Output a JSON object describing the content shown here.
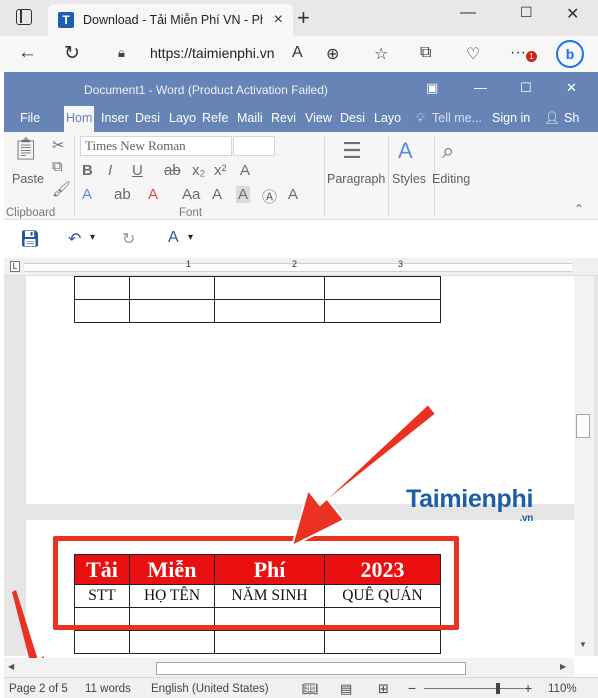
{
  "browser": {
    "tab_title": "Download - Tải Miễn Phí VN - Ph",
    "tab_favicon": "T",
    "url": "https://taimienphi.vn",
    "notification_count": "1",
    "bing_label": "b"
  },
  "word": {
    "window_title": "Document1 - Word (Product Activation Failed)",
    "ribbon_tabs": [
      "File",
      "Hom",
      "Inser",
      "Desi",
      "Layo",
      "Refe",
      "Maili",
      "Revi",
      "View",
      "Desi",
      "Layo"
    ],
    "tell_me": "Tell me...",
    "sign_in": "Sign in",
    "share": "Sh",
    "font_name": "Times New Roman",
    "groups": {
      "clipboard": "Clipboard",
      "font": "Font",
      "paste": "Paste",
      "paragraph": "Paragraph",
      "styles": "Styles",
      "editing": "Editing"
    },
    "ruler_numbers": [
      "1",
      "2",
      "3"
    ],
    "table": {
      "header": [
        "Tải",
        "Miễn",
        "Phí",
        "2023"
      ],
      "row1": [
        "STT",
        "HỌ TÊN",
        "NĂM SINH",
        "QUÊ QUÁN"
      ]
    },
    "watermark_text": "Taimienphi",
    "watermark_suffix": ".vn",
    "status": {
      "page": "Page 2 of 5",
      "words": "11 words",
      "language": "English (United States)",
      "zoom": "110%"
    }
  },
  "colors": {
    "word_blue": "#2b579a",
    "header_red": "#ea0f10",
    "arrow_red": "#ea3122"
  }
}
